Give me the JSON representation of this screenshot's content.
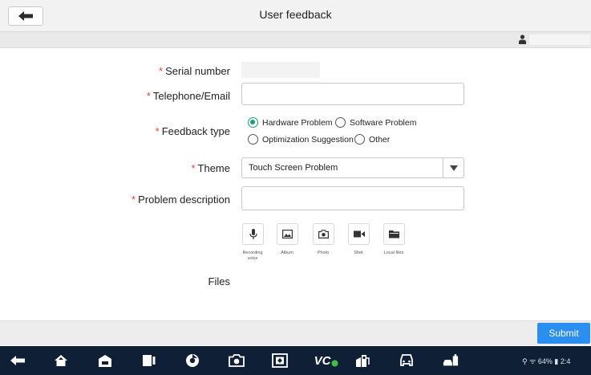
{
  "header": {
    "title": "User feedback"
  },
  "form": {
    "serial_label": "Serial number",
    "contact_label": "Telephone/Email",
    "feedback_type_label": "Feedback type",
    "theme_label": "Theme",
    "problem_label": "Problem description",
    "files_label": "Files",
    "required_marker": "*",
    "feedback_options": [
      {
        "label": "Hardware Problem",
        "checked": true
      },
      {
        "label": "Software Problem",
        "checked": false
      },
      {
        "label": "Optimization Suggestion",
        "checked": false
      },
      {
        "label": "Other",
        "checked": false
      }
    ],
    "theme_value": "Touch Screen Problem",
    "media_buttons": [
      {
        "label": "Recording voice",
        "icon": "microphone-icon"
      },
      {
        "label": "Album",
        "icon": "image-icon"
      },
      {
        "label": "Photo",
        "icon": "camera-icon"
      },
      {
        "label": "Shot",
        "icon": "video-icon"
      },
      {
        "label": "Local files",
        "icon": "folder-icon"
      }
    ]
  },
  "footer": {
    "submit_label": "Submit"
  },
  "status_bar": {
    "battery": "64%",
    "time": "2:4"
  },
  "nav_bar": {
    "vci_label": "VC"
  },
  "colors": {
    "accent": "#2a8ff0",
    "required": "#e0463b",
    "radio_checked": "#1a9e77",
    "nav_background": "#0f1f36"
  }
}
